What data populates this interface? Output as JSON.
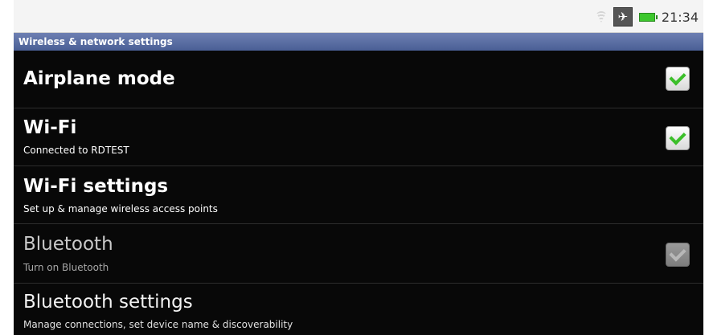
{
  "status_bar": {
    "time": "21:34",
    "icons": [
      "wifi-signal-icon",
      "airplane-mode-icon",
      "battery-icon"
    ]
  },
  "header": {
    "title": "Wireless & network settings"
  },
  "settings": [
    {
      "title": "Airplane mode",
      "subtitle": "",
      "checkbox": true,
      "checked": true,
      "enabled": true
    },
    {
      "title": "Wi-Fi",
      "subtitle": "Connected to RDTEST",
      "checkbox": true,
      "checked": true,
      "enabled": true
    },
    {
      "title": "Wi-Fi settings",
      "subtitle": "Set up & manage wireless access points",
      "checkbox": false,
      "enabled": true
    },
    {
      "title": "Bluetooth",
      "subtitle": "Turn on Bluetooth",
      "checkbox": true,
      "checked": true,
      "enabled": false
    },
    {
      "title": "Bluetooth settings",
      "subtitle": "Manage connections, set device name & discoverability",
      "checkbox": false,
      "enabled": true
    }
  ],
  "colors": {
    "title_bar": "#5a6ea5",
    "check_green": "#3cbf2a",
    "background": "#080808"
  }
}
